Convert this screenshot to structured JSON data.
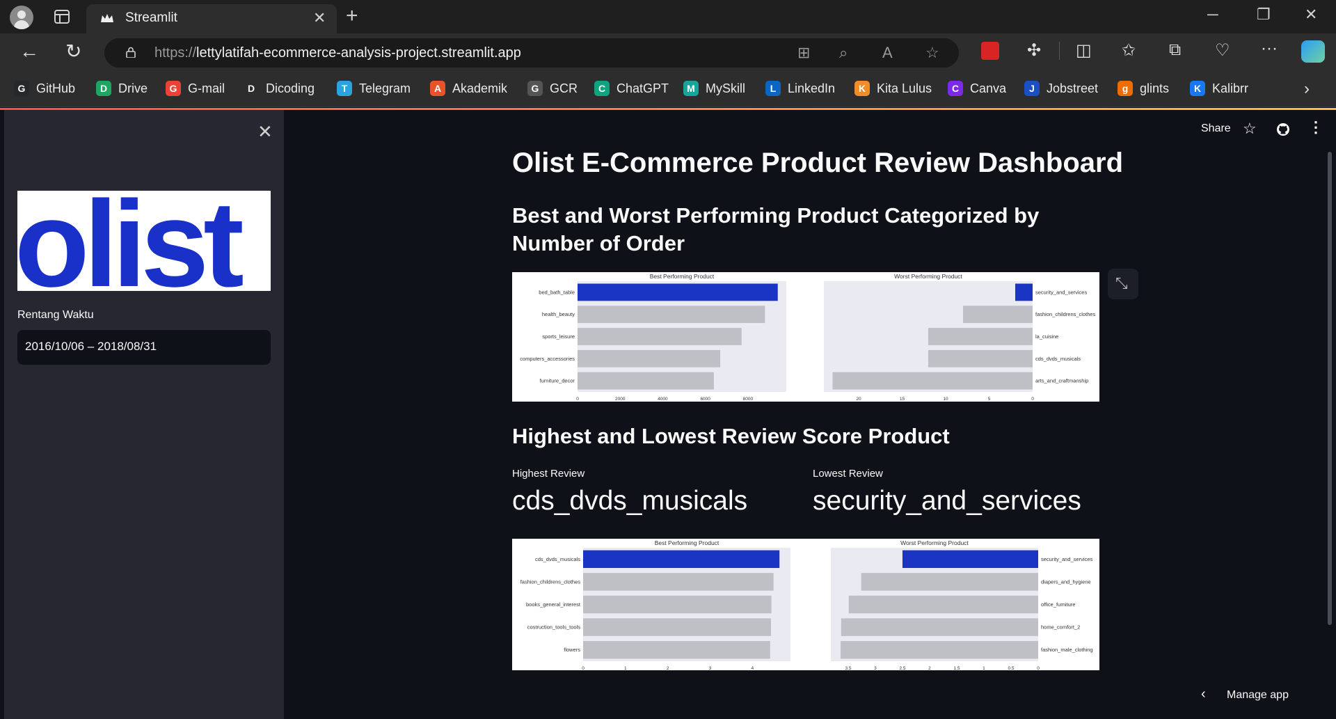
{
  "browser": {
    "tab_title": "Streamlit",
    "url_prefix": "https://",
    "url_host": "lettylatifah-ecommerce-analysis-project.streamlit.app",
    "bookmarks": [
      {
        "label": "GitHub",
        "icon": "github-icon",
        "color": "#24292e"
      },
      {
        "label": "Drive",
        "icon": "drive-icon",
        "color": "#1fa463"
      },
      {
        "label": "G-mail",
        "icon": "gmail-icon",
        "color": "#ea4335"
      },
      {
        "label": "Dicoding",
        "icon": "dicoding-icon",
        "color": "#2d2d2d"
      },
      {
        "label": "Telegram",
        "icon": "telegram-icon",
        "color": "#2aa3df"
      },
      {
        "label": "Akademik",
        "icon": "akademik-icon",
        "color": "#e8542a"
      },
      {
        "label": "GCR",
        "icon": "gcr-icon",
        "color": "#555555"
      },
      {
        "label": "ChatGPT",
        "icon": "chatgpt-icon",
        "color": "#10a37f"
      },
      {
        "label": "MySkill",
        "icon": "myskill-icon",
        "color": "#1aa39a"
      },
      {
        "label": "LinkedIn",
        "icon": "linkedin-icon",
        "color": "#0a66c2"
      },
      {
        "label": "Kita Lulus",
        "icon": "kitalulus-icon",
        "color": "#f28c28"
      },
      {
        "label": "Canva",
        "icon": "canva-icon",
        "color": "#7d2ae8"
      },
      {
        "label": "Jobstreet",
        "icon": "jobstreet-icon",
        "color": "#1c4fc4"
      },
      {
        "label": "glints",
        "icon": "glints-icon",
        "color": "#ef6c00"
      },
      {
        "label": "Kalibrr",
        "icon": "kalibrr-icon",
        "color": "#1877f2"
      }
    ]
  },
  "sidebar": {
    "logo_text": "olist",
    "date_label": "Rentang Waktu",
    "date_value": "2016/10/06 – 2018/08/31"
  },
  "header": {
    "share": "Share",
    "manage_app": "Manage app"
  },
  "main": {
    "title": "Olist E-Commerce Product Review Dashboard",
    "section1_title": "Best and Worst Performing Product Categorized by Number of Order",
    "section2_title": "Highest and Lowest Review Score Product",
    "metric_high_label": "Highest Review",
    "metric_high_value": "cds_dvds_musicals",
    "metric_low_label": "Lowest Review",
    "metric_low_value": "security_and_services"
  },
  "colors": {
    "highlight_bar": "#1a35c4",
    "other_bar": "#bfc0c5",
    "axes_bg": "#eaeaf2",
    "olist_blue": "#1a31c9"
  },
  "chart_data": [
    {
      "type": "bar",
      "orientation": "horizontal",
      "title": "Best Performing Product",
      "categories": [
        "bed_bath_table",
        "health_beauty",
        "sports_leisure",
        "computers_accessories",
        "furniture_decor"
      ],
      "values": [
        9400,
        8800,
        7700,
        6700,
        6400
      ],
      "xticks": [
        0,
        2000,
        4000,
        6000,
        8000
      ],
      "xlim": [
        0,
        9800
      ],
      "y_axis_side": "left",
      "inverted_x": false
    },
    {
      "type": "bar",
      "orientation": "horizontal",
      "title": "Worst Performing Product",
      "categories": [
        "security_and_services",
        "fashion_childrens_clothes",
        "la_cuisine",
        "cds_dvds_musicals",
        "arts_and_craftmanship"
      ],
      "values": [
        2,
        8,
        12,
        12,
        23
      ],
      "xticks": [
        20,
        15,
        10,
        5,
        0
      ],
      "xlim": [
        0,
        24
      ],
      "y_axis_side": "right",
      "inverted_x": true
    },
    {
      "type": "bar",
      "orientation": "horizontal",
      "title": "Best Performing Product",
      "categories": [
        "cds_dvds_musicals",
        "fashion_childrens_clothes",
        "books_general_interest",
        "costruction_tools_tools",
        "flowers"
      ],
      "values": [
        4.64,
        4.5,
        4.45,
        4.44,
        4.42
      ],
      "xticks": [
        0,
        1,
        2,
        3,
        4
      ],
      "xlim": [
        0,
        4.9
      ],
      "y_axis_side": "left",
      "inverted_x": false
    },
    {
      "type": "bar",
      "orientation": "horizontal",
      "title": "Worst Performing Product",
      "categories": [
        "security_and_services",
        "diapers_and_hygiene",
        "office_furniture",
        "home_comfort_2",
        "fashion_male_clothing"
      ],
      "values": [
        2.5,
        3.26,
        3.49,
        3.63,
        3.64
      ],
      "xticks": [
        3.5,
        3.0,
        2.5,
        2.0,
        1.5,
        1.0,
        0.5,
        0.0
      ],
      "xlim": [
        0,
        3.82
      ],
      "y_axis_side": "right",
      "inverted_x": true
    }
  ]
}
